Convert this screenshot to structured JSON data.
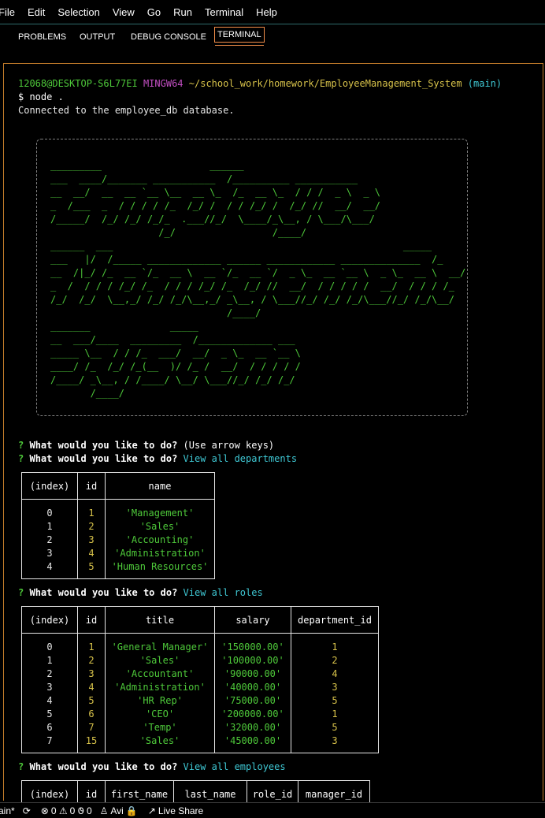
{
  "menu": [
    "File",
    "Edit",
    "Selection",
    "View",
    "Go",
    "Run",
    "Terminal",
    "Help"
  ],
  "tabs": [
    "PROBLEMS",
    "OUTPUT",
    "DEBUG CONSOLE",
    "TERMINAL"
  ],
  "prompt": {
    "user": "12068@DESKTOP-S6L77EI",
    "env": "MINGW64",
    "path": "~/school_work/homework/EmployeeManagement_System",
    "branch": "(main)",
    "command": "$ node .",
    "output": "Connected to the employee_db database."
  },
  "banner": {
    "lines": [
      "_________                   ______",
      "___  ____/_______ ___________  /__________ ___________",
      "__  __/  __  __ `__ \\__  __ \\_  /_  __ \\_  / / /  _ \\  _ \\",
      "_  /___  _  / / / / /_  /_/ /  / / /_/ /  /_/ //  __/  __/",
      "/_____/  /_/ /_/ /_/_  .___//_/  \\____/_\\__, / \\___/\\___/",
      "                   /_/                 /____/",
      "______  ___                                                   _____",
      "___   |/  /_____ _____________ ______ ____________ ______________  /_",
      "__  /|_/ /_  __ `/_  __ \\  __ `/_  __ `/  _ \\_  __ `__ \\  _ \\_  __ \\  __/",
      "_  /  / / / /_/ /_  / / / /_/ /_  /_/ //  __/  / / / / /  __/  / / / /_",
      "/_/  /_/  \\__,_/ /_/ /_/\\__,_/ _\\__, / \\___//_/ /_/ /_/\\___//_/ /_/\\__/",
      "                               /____/",
      "_______              _____",
      "__  ___/____  _________  /_____________ ___",
      "_____ \\__  / / /_  ___/  __/  _ \\_  __ `__ \\",
      "____/ /_  /_/ /_(__  )/ /_ /  __/  / / / / /",
      "/____/ _\\__, / /____/ \\__/ \\___//_/ /_/ /_/",
      "       /____/"
    ]
  },
  "q1": {
    "mark": "?",
    "question": "What would you like to do?",
    "hint": "(Use arrow keys)"
  },
  "q2": {
    "mark": "?",
    "question": "What would you like to do?",
    "answer": "View all departments"
  },
  "departments": {
    "headers": [
      "(index)",
      "id",
      "name"
    ],
    "rows": [
      [
        "0",
        "1",
        "'Management'"
      ],
      [
        "1",
        "2",
        "'Sales'"
      ],
      [
        "2",
        "3",
        "'Accounting'"
      ],
      [
        "3",
        "4",
        "'Administration'"
      ],
      [
        "4",
        "5",
        "'Human Resources'"
      ]
    ]
  },
  "q3": {
    "mark": "?",
    "question": "What would you like to do?",
    "answer": "View all roles"
  },
  "roles": {
    "headers": [
      "(index)",
      "id",
      "title",
      "salary",
      "department_id"
    ],
    "rows": [
      [
        "0",
        "1",
        "'General Manager'",
        "'150000.00'",
        "1"
      ],
      [
        "1",
        "2",
        "'Sales'",
        "'100000.00'",
        "2"
      ],
      [
        "2",
        "3",
        "'Accountant'",
        "'90000.00'",
        "4"
      ],
      [
        "3",
        "4",
        "'Administration'",
        "'40000.00'",
        "3"
      ],
      [
        "4",
        "5",
        "'HR Rep'",
        "'75000.00'",
        "5"
      ],
      [
        "5",
        "6",
        "'CEO'",
        "'200000.00'",
        "1"
      ],
      [
        "6",
        "7",
        "'Temp'",
        "'32000.00'",
        "5"
      ],
      [
        "7",
        "15",
        "'Sales'",
        "'45000.00'",
        "3"
      ]
    ]
  },
  "q4": {
    "mark": "?",
    "question": "What would you like to do?",
    "answer": "View all employees"
  },
  "employees": {
    "headers": [
      "(index)",
      "id",
      "first_name",
      "last_name",
      "role_id",
      "manager_id"
    ]
  },
  "status": {
    "branch": "ain*",
    "errors": "0",
    "warnings": "0",
    "zero": "0",
    "user": "Avi",
    "liveshare": "Live Share"
  }
}
